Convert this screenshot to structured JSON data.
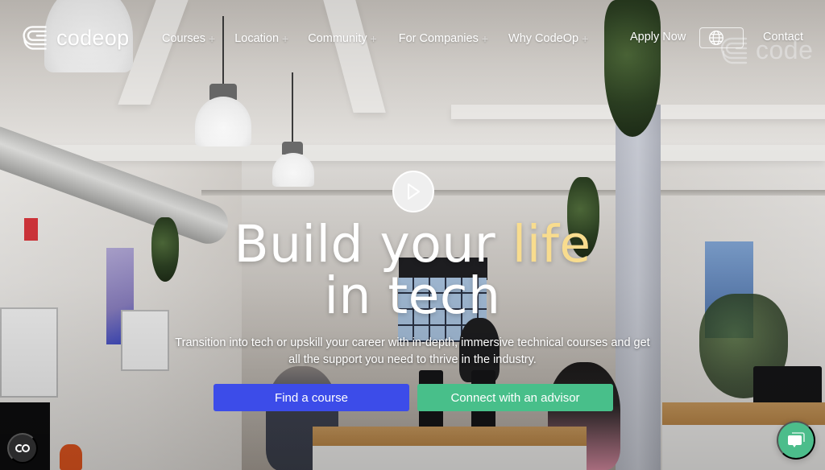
{
  "brand": {
    "name": "codeop",
    "logo_icon": "codeop-logo-icon"
  },
  "nav": {
    "items": [
      {
        "label": "Courses",
        "has_submenu": true,
        "indicator": "+"
      },
      {
        "label": "Location",
        "has_submenu": true,
        "indicator": "+"
      },
      {
        "label": "Community",
        "has_submenu": true,
        "indicator": "+"
      },
      {
        "label": "For Companies",
        "has_submenu": true,
        "indicator": "+"
      },
      {
        "label": "Why CodeOp",
        "has_submenu": true,
        "indicator": "+"
      }
    ],
    "apply_label": "Apply Now",
    "language_icon": "globe-icon",
    "contact_label": "Contact"
  },
  "hero": {
    "play_icon": "play-icon",
    "headline_part1": "Build your ",
    "headline_accent": "life",
    "headline_part2": "in tech",
    "subtext": "Transition into tech or upskill your career with in-depth, immersive technical courses and get all the support you need to thrive in the industry.",
    "primary_cta": "Find a course",
    "secondary_cta": "Connect with an advisor",
    "background_watermark": "code"
  },
  "widgets": {
    "cookie_icon": "cookie-settings-icon",
    "chat_icon": "chat-bubbles-icon"
  },
  "colors": {
    "primary_button": "#3c4ce9",
    "secondary_button": "#48bf8a",
    "headline_accent": "#f8dc8e",
    "chat_button": "#4cbd8b",
    "text": "#ffffff"
  }
}
